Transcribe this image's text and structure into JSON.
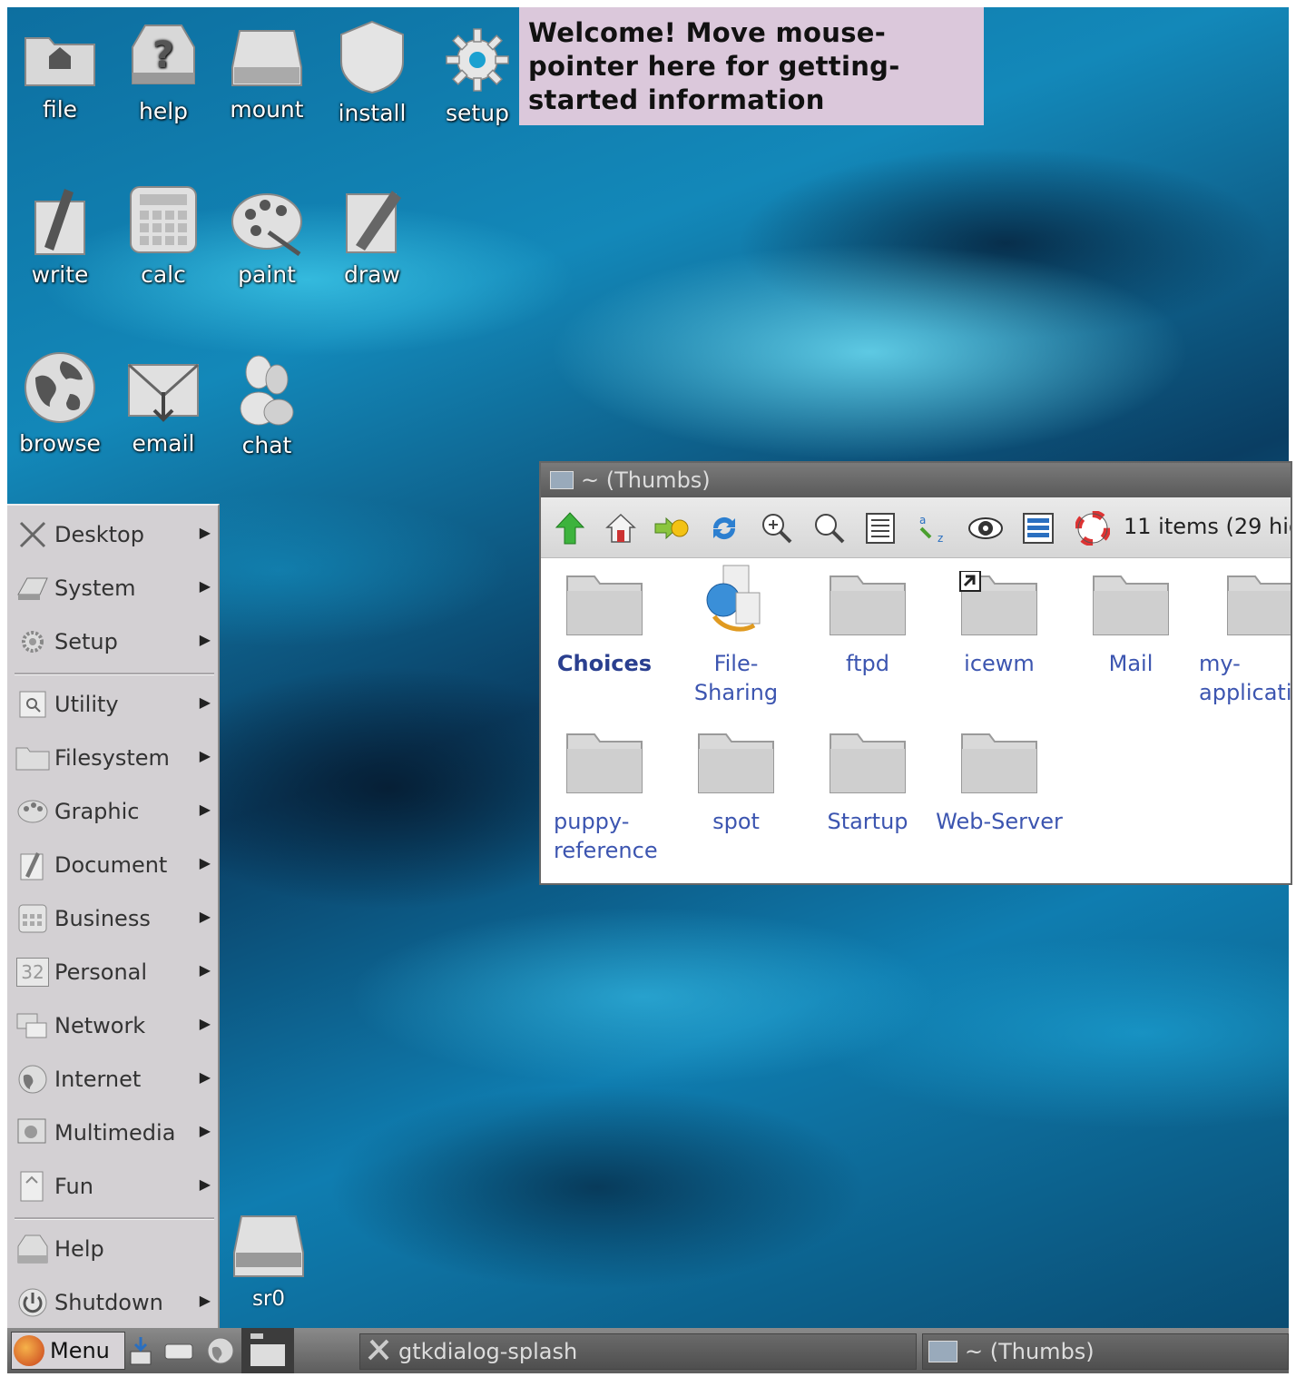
{
  "desktop": {
    "icons": [
      {
        "label": "file",
        "icon": "folder-icon"
      },
      {
        "label": "help",
        "icon": "help-box-icon"
      },
      {
        "label": "mount",
        "icon": "drive-icon"
      },
      {
        "label": "install",
        "icon": "shield-icon"
      },
      {
        "label": "setup",
        "icon": "gear-icon"
      },
      {
        "label": "write",
        "icon": "write-icon"
      },
      {
        "label": "calc",
        "icon": "calculator-icon"
      },
      {
        "label": "paint",
        "icon": "palette-icon"
      },
      {
        "label": "draw",
        "icon": "pen-icon"
      },
      {
        "label": "browse",
        "icon": "globe-icon"
      },
      {
        "label": "email",
        "icon": "envelope-icon"
      },
      {
        "label": "chat",
        "icon": "chat-people-icon"
      }
    ],
    "sr0_label": "sr0",
    "welcome_text": "Welcome! Move mouse-pointer here for getting-started information"
  },
  "start_menu": {
    "items": [
      {
        "label": "Desktop",
        "icon": "desktop-icon",
        "submenu": true
      },
      {
        "label": "System",
        "icon": "system-icon",
        "submenu": true
      },
      {
        "label": "Setup",
        "icon": "gear-icon",
        "submenu": true
      },
      {
        "label": "Utility",
        "icon": "utility-icon",
        "submenu": true
      },
      {
        "label": "Filesystem",
        "icon": "folder-icon",
        "submenu": true
      },
      {
        "label": "Graphic",
        "icon": "palette-icon",
        "submenu": true
      },
      {
        "label": "Document",
        "icon": "document-icon",
        "submenu": true
      },
      {
        "label": "Business",
        "icon": "calculator-icon",
        "submenu": true
      },
      {
        "label": "Personal",
        "icon": "calendar-icon",
        "submenu": true
      },
      {
        "label": "Network",
        "icon": "network-icon",
        "submenu": true
      },
      {
        "label": "Internet",
        "icon": "globe-icon",
        "submenu": true
      },
      {
        "label": "Multimedia",
        "icon": "multimedia-icon",
        "submenu": true
      },
      {
        "label": "Fun",
        "icon": "fun-icon",
        "submenu": true
      },
      {
        "label": "Help",
        "icon": "help-icon",
        "submenu": false
      },
      {
        "label": "Shutdown",
        "icon": "power-icon",
        "submenu": true
      }
    ],
    "personal_icon_text": "32"
  },
  "file_manager": {
    "title": "~ (Thumbs)",
    "status": "11 items (29 hid",
    "items": [
      {
        "label": "Choices",
        "bold": true
      },
      {
        "label": "File-Sharing"
      },
      {
        "label": "ftpd"
      },
      {
        "label": "icewm",
        "symlink": true
      },
      {
        "label": "Mail"
      },
      {
        "label": "my-\napplicati"
      },
      {
        "label": "puppy-\nreference"
      },
      {
        "label": "spot"
      },
      {
        "label": "Startup"
      },
      {
        "label": "Web-Server"
      }
    ]
  },
  "taskbar": {
    "menu_label": "Menu",
    "tasks": [
      {
        "label": "gtkdialog-splash"
      },
      {
        "label": "~ (Thumbs)"
      }
    ]
  }
}
